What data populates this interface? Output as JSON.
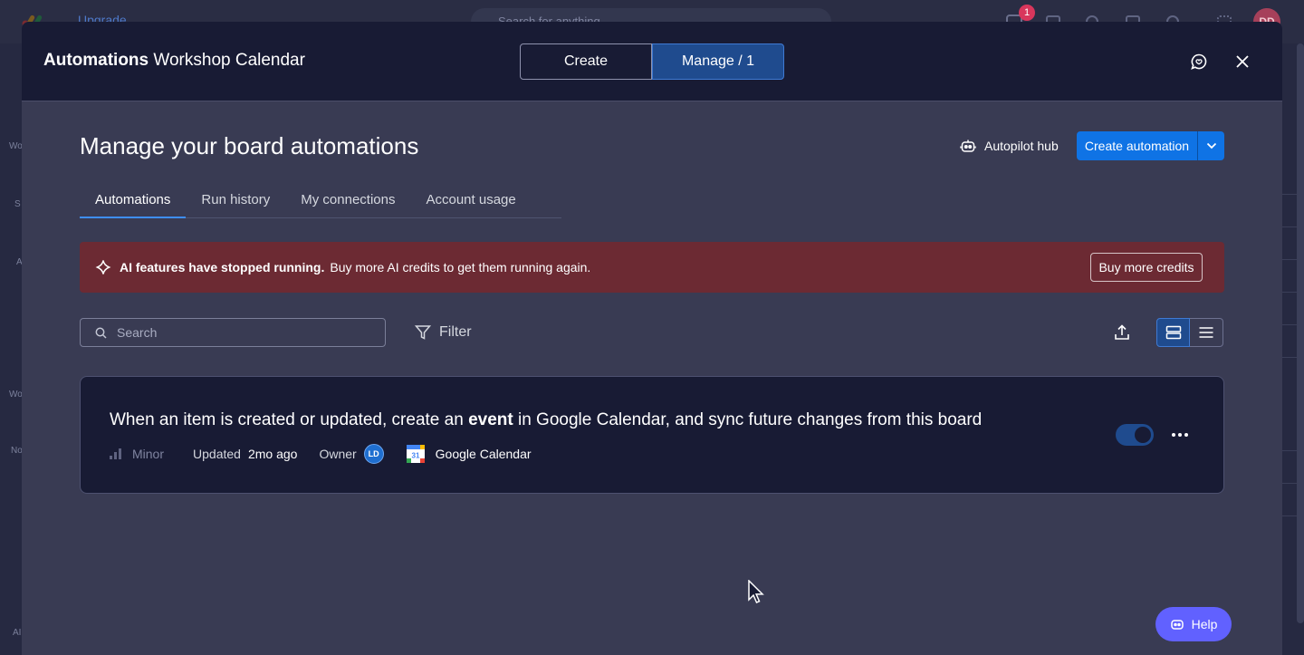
{
  "background": {
    "upgrade_label": "Upgrade",
    "search_placeholder": "Search for anything",
    "notification_count": "1",
    "avatar_initials": "DD",
    "side_labels": [
      "Wo",
      "S",
      "A",
      "Wo",
      "No",
      "AI"
    ]
  },
  "modal": {
    "title_bold": "Automations",
    "title_rest": " Workshop Calendar",
    "tabs_top": [
      {
        "label": "Create"
      },
      {
        "label": "Manage / 1"
      }
    ]
  },
  "page": {
    "heading": "Manage your board automations",
    "autopilot_label": "Autopilot hub",
    "create_label": "Create automation",
    "tabs": [
      {
        "label": "Automations"
      },
      {
        "label": "Run history"
      },
      {
        "label": "My connections"
      },
      {
        "label": "Account usage"
      }
    ]
  },
  "banner": {
    "bold": "AI features have stopped running.",
    "text": "Buy more AI credits to get them running again.",
    "button": "Buy more credits",
    "color": "#6c2a33"
  },
  "toolbar": {
    "search_placeholder": "Search",
    "filter_label": "Filter"
  },
  "automation": {
    "desc_before": "When an item is created or updated, create an ",
    "desc_bold": "event",
    "desc_after": " in Google Calendar, and sync future changes from this board",
    "impact": "Minor",
    "updated_label": "Updated",
    "updated_value": "2mo ago",
    "owner_label": "Owner",
    "owner_initials": "LD",
    "integration_icon_text": "31",
    "integration": "Google Calendar",
    "enabled": true
  },
  "help_label": "Help",
  "colors": {
    "accent": "#0f73e5",
    "header": "#181b34",
    "modal_bg": "#393b53",
    "help": "#6161ff"
  }
}
